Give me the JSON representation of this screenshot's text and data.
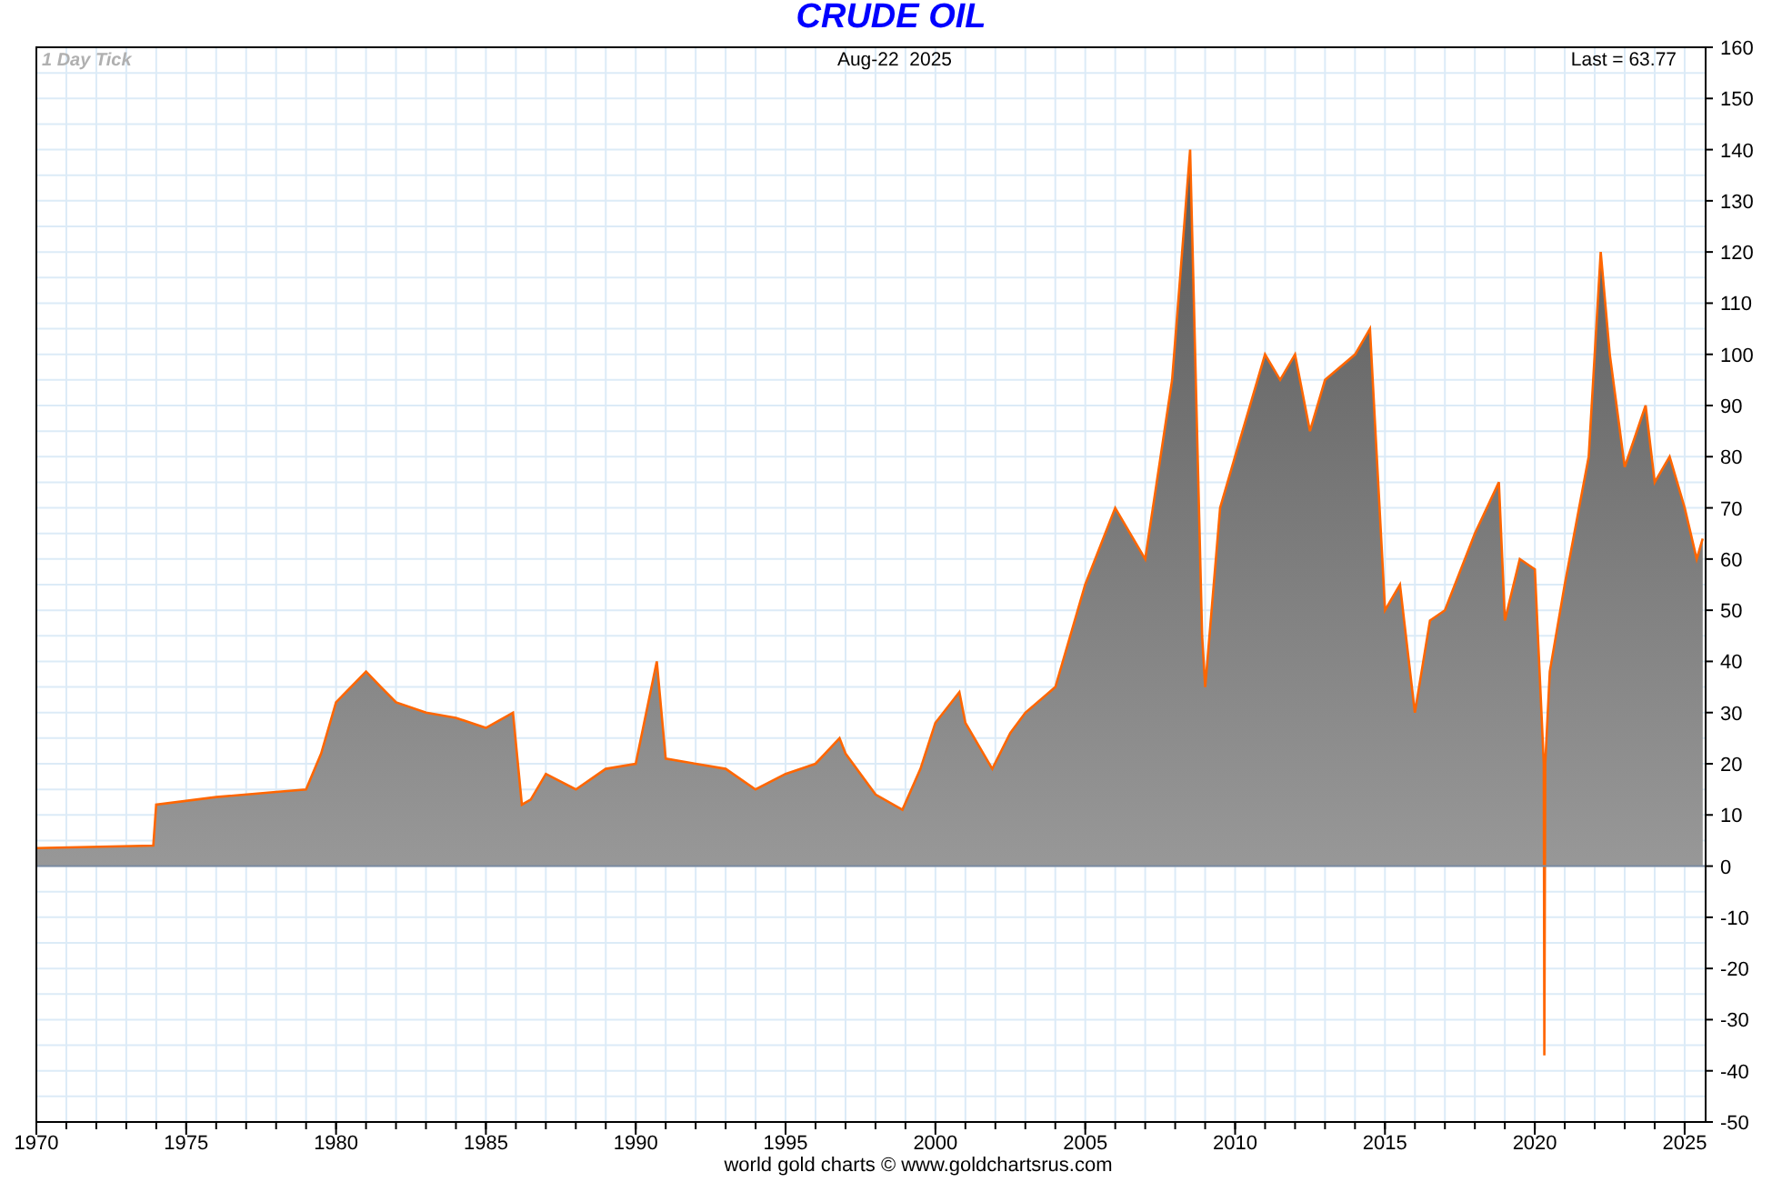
{
  "header": {
    "interval": "1 Day Tick",
    "date": "Aug-22  2025",
    "last": "Last = 63.77"
  },
  "chart_data": {
    "type": "area",
    "title": "CRUDE OIL",
    "grid": true,
    "xlim": [
      1970,
      2025.7
    ],
    "ylim": [
      -50,
      160
    ],
    "xticks": [
      1970,
      1975,
      1980,
      1985,
      1990,
      1995,
      2000,
      2005,
      2010,
      2015,
      2020,
      2025
    ],
    "yticks": [
      -50,
      -40,
      -30,
      -20,
      -10,
      0,
      10,
      20,
      30,
      40,
      50,
      60,
      70,
      80,
      90,
      100,
      110,
      120,
      130,
      140,
      150,
      160
    ],
    "x": [
      1970,
      1973.9,
      1974,
      1976,
      1978,
      1979,
      1979.5,
      1980,
      1981,
      1981.5,
      1982,
      1983,
      1984,
      1985,
      1985.9,
      1986.2,
      1986.5,
      1987,
      1988,
      1989,
      1990,
      1990.7,
      1991,
      1992,
      1993,
      1994,
      1995,
      1996,
      1996.8,
      1997,
      1998,
      1998.9,
      1999.5,
      2000,
      2000.8,
      2001,
      2001.9,
      2002.5,
      2003,
      2004,
      2005,
      2006,
      2007,
      2007.9,
      2008.5,
      2008.9,
      2009,
      2009.5,
      2010,
      2011,
      2011.5,
      2012,
      2012.5,
      2013,
      2014,
      2014.5,
      2015,
      2015.5,
      2016,
      2016.5,
      2017,
      2018,
      2018.8,
      2019,
      2019.5,
      2020,
      2020.3,
      2020.32,
      2020.35,
      2020.5,
      2021,
      2021.8,
      2022.2,
      2022.5,
      2023,
      2023.7,
      2024,
      2024.5,
      2025,
      2025.4,
      2025.6
    ],
    "series": [
      {
        "color": "#ff6600",
        "values": [
          3.5,
          4,
          12,
          13.5,
          14.5,
          15,
          22,
          32,
          38,
          35,
          32,
          30,
          29,
          27,
          30,
          12,
          13,
          18,
          15,
          19,
          20,
          40,
          21,
          20,
          19,
          15,
          18,
          20,
          25,
          22,
          14,
          11,
          19,
          28,
          34,
          28,
          19,
          26,
          30,
          35,
          55,
          70,
          60,
          95,
          140,
          45,
          35,
          70,
          80,
          100,
          95,
          100,
          85,
          95,
          100,
          105,
          50,
          55,
          30,
          48,
          50,
          65,
          75,
          48,
          60,
          58,
          20,
          -37,
          20,
          38,
          55,
          80,
          120,
          100,
          78,
          90,
          75,
          80,
          70,
          60,
          64
        ]
      }
    ]
  },
  "footer": "world gold charts © www.goldchartsrus.com"
}
